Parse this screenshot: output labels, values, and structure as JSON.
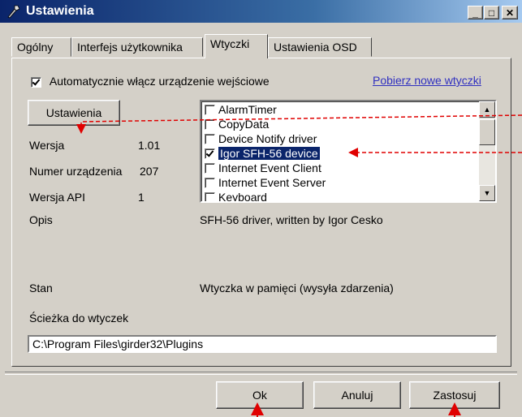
{
  "window": {
    "title": "Ustawienia",
    "minimize_glyph": "_",
    "maximize_glyph": "□",
    "close_glyph": "✕"
  },
  "tabs": [
    {
      "label": "Ogólny"
    },
    {
      "label": "Interfejs użytkownika"
    },
    {
      "label": "Wtyczki"
    },
    {
      "label": "Ustawienia OSD"
    }
  ],
  "active_tab": "Wtyczki",
  "plugins": {
    "auto_enable": {
      "label": "Automatycznie włącz urządzenie wejściowe",
      "checked": true
    },
    "download_link": "Pobierz nowe wtyczki",
    "settings_button": "Ustawienia",
    "version_label": "Wersja",
    "version_value": "1.01",
    "device_number_label": "Numer urządzenia",
    "device_number_value": "207",
    "api_version_label": "Wersja API",
    "api_version_value": "1",
    "description_label": "Opis",
    "description_value": "SFH-56 driver, written by Igor Cesko",
    "status_label": "Stan",
    "status_value": "Wtyczka w pamięci (wysyła zdarzenia)",
    "path_label": "Ścieżka do wtyczek",
    "path_value": "C:\\Program Files\\girder32\\Plugins",
    "list": [
      {
        "name": "AlarmTimer",
        "checked": false
      },
      {
        "name": "CopyData",
        "checked": false
      },
      {
        "name": "Device Notify driver",
        "checked": false
      },
      {
        "name": "Igor SFH-56 device",
        "checked": true,
        "selected": true
      },
      {
        "name": "Internet Event Client",
        "checked": false
      },
      {
        "name": "Internet Event Server",
        "checked": false
      },
      {
        "name": "Keyboard",
        "checked": false
      }
    ]
  },
  "footer": {
    "ok": "Ok",
    "cancel": "Anuluj",
    "apply": "Zastosuj"
  },
  "colors": {
    "accent_red": "#e00000",
    "selection": "#0a246a",
    "link": "#3030c0"
  }
}
